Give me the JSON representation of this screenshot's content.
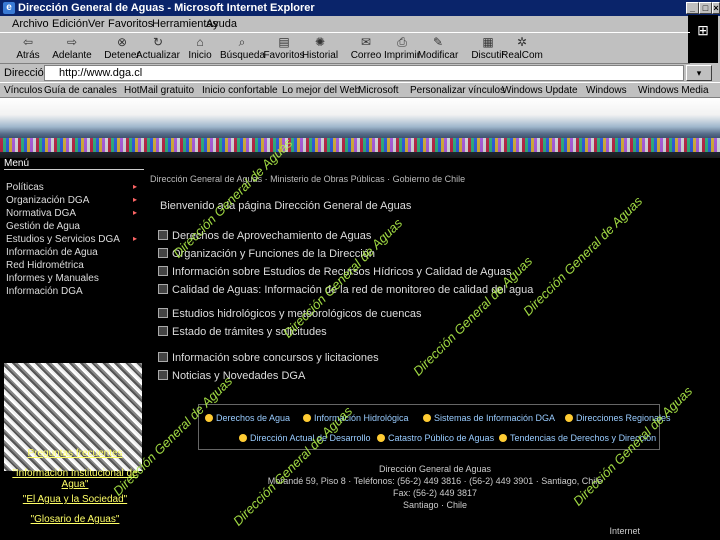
{
  "window": {
    "title": "Dirección General de Aguas - Microsoft Internet Explorer",
    "minimize": "_",
    "maximize": "□",
    "close": "×"
  },
  "menu": [
    "Archivo",
    "Edición",
    "Ver",
    "Favoritos",
    "Herramientas",
    "Ayuda"
  ],
  "toolbar": [
    "Atrás",
    "Adelante",
    "Detener",
    "Actualizar",
    "Inicio",
    "Búsqueda",
    "Favoritos",
    "Historial",
    "Correo",
    "Imprimir",
    "Modificar",
    "Discutir",
    "RealCom"
  ],
  "address": {
    "label": "Dirección",
    "value": "http://www.dga.cl",
    "go": "▾"
  },
  "links": {
    "label": "Vínculos",
    "items": [
      "Guía de canales",
      "HotMail gratuito",
      "Inicio confortable",
      "Lo mejor del Web",
      "Microsoft",
      "Personalizar vínculos",
      "Windows Update",
      "Windows",
      "Windows Media"
    ]
  },
  "sidebar": {
    "title": "Menú",
    "items": [
      "Políticas",
      "Organización DGA",
      "Normativa DGA",
      "Gestión de Agua",
      "Estudios y Servicios DGA",
      "Información de Agua",
      "Red Hidrométrica",
      "Informes y Manuales",
      "Información DGA"
    ],
    "promo": [
      "Preguntas frecuentes",
      "\"Información Institucional de Agua\"",
      "\"El Agua y la Sociedad\"",
      "\"Glosario de Aguas\""
    ]
  },
  "main": {
    "header": "Dirección General de Aguas · Ministerio de Obras Públicas · Gobierno de Chile",
    "title": "Bienvenido a la página Dirección General de Aguas",
    "bullets": [
      "Derechos de Aprovechamiento de Aguas",
      "Organización y Funciones de la Dirección",
      "Información sobre Estudios de Recursos Hídricos y Calidad de Aguas",
      "Calidad de Aguas: Información de la red de monitoreo de calidad del agua",
      "Estudios hidrológicos y meteorológicos de cuencas",
      "Estado de trámites y solicitudes",
      "Información sobre concursos y licitaciones",
      "Noticias y Novedades DGA"
    ],
    "bottom_links": [
      "Derechos de Agua",
      "Información Hidrológica",
      "Sistemas de Información DGA",
      "Direcciones Regionales",
      "Dirección Actual de Desarrollo",
      "Catastro Público de Aguas",
      "Tendencias de Derechos y Dirección"
    ],
    "footer": [
      "Dirección General de Aguas",
      "Morandé 59, Piso 8 · Teléfonos: (56-2) 449 3816 · (56-2) 449 3901 · Santiago, Chile",
      "Fax: (56-2) 449 3817",
      "Santiago · Chile"
    ],
    "watermark": "Dirección General de Aguas"
  },
  "status": {
    "zone": "Internet"
  }
}
